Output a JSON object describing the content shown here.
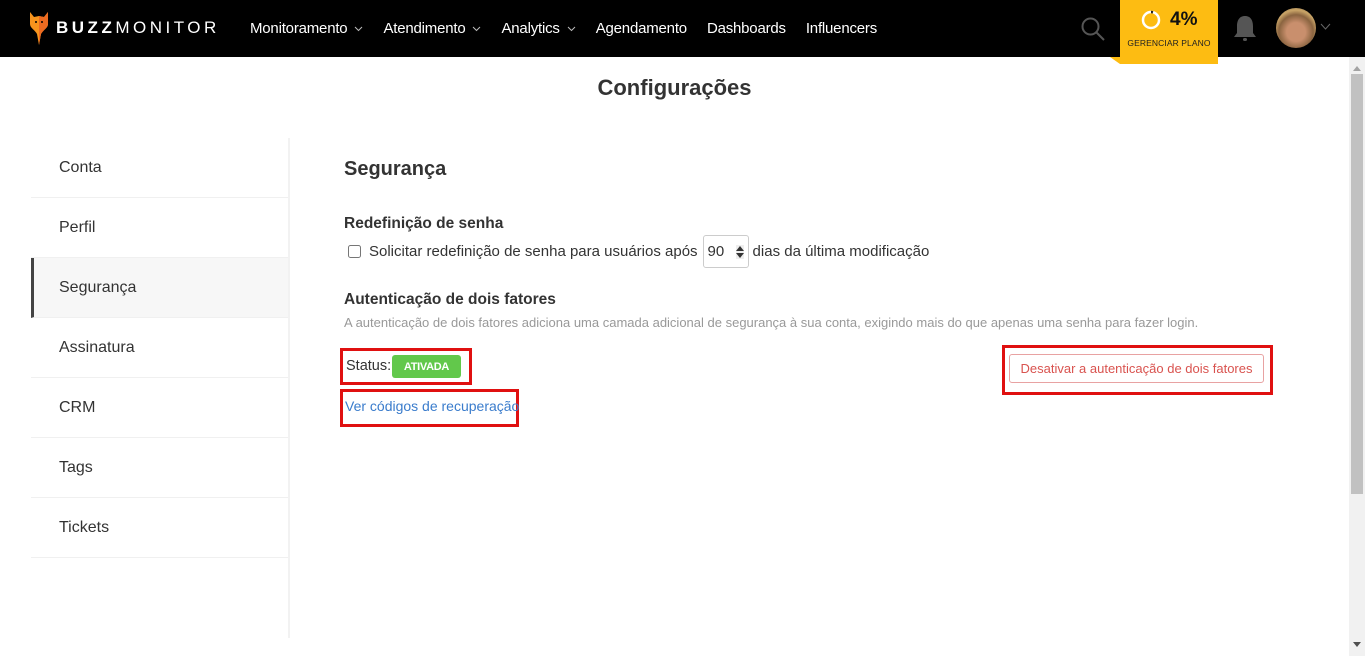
{
  "app": {
    "brand_bold": "BUZZ",
    "brand_light": "MONITOR"
  },
  "nav": {
    "items": [
      {
        "label": "Monitoramento",
        "has_dropdown": true
      },
      {
        "label": "Atendimento",
        "has_dropdown": true
      },
      {
        "label": "Analytics",
        "has_dropdown": true
      },
      {
        "label": "Agendamento",
        "has_dropdown": false
      },
      {
        "label": "Dashboards",
        "has_dropdown": false
      },
      {
        "label": "Influencers",
        "has_dropdown": false
      }
    ]
  },
  "plan": {
    "percent_label": "4%",
    "usage_fraction": 0.04,
    "label": "GERENCIAR PLANO",
    "color": "#fdbc12"
  },
  "page": {
    "title": "Configurações"
  },
  "sidebar": {
    "items": [
      {
        "label": "Conta",
        "active": false
      },
      {
        "label": "Perfil",
        "active": false
      },
      {
        "label": "Segurança",
        "active": true
      },
      {
        "label": "Assinatura",
        "active": false
      },
      {
        "label": "CRM",
        "active": false
      },
      {
        "label": "Tags",
        "active": false
      },
      {
        "label": "Tickets",
        "active": false
      }
    ]
  },
  "security": {
    "title": "Segurança",
    "password_reset": {
      "title": "Redefinição de senha",
      "checkbox_label_before": "Solicitar redefinição de senha para usuários após",
      "days_value": "90",
      "checkbox_label_after": "dias da última modificação",
      "checked": false
    },
    "two_factor": {
      "title": "Autenticação de dois fatores",
      "description": "A autenticação de dois fatores adiciona uma camada adicional de segurança à sua conta, exigindo mais do que apenas uma senha para fazer login.",
      "status_label": "Status:",
      "status_value": "ATIVADA",
      "status_color": "#62c84b",
      "recovery_link": "Ver códigos de recuperação",
      "disable_button": "Desativar a autenticação de dois fatores",
      "danger_color": "#d9534f"
    }
  }
}
